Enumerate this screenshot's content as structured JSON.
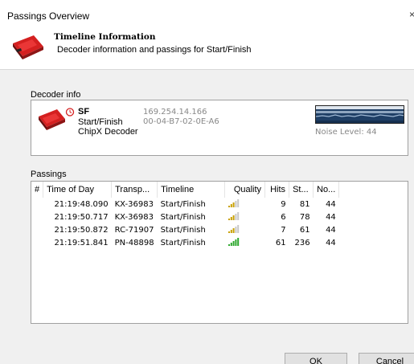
{
  "window": {
    "title": "Passings Overview",
    "close_glyph": "×"
  },
  "header": {
    "title": "Timeline Information",
    "subtitle": "Decoder information and passings for Start/Finish"
  },
  "decoder_info": {
    "group_label": "Decoder info",
    "id": "SF",
    "timeline": "Start/Finish",
    "type": "ChipX Decoder",
    "ip": "169.254.14.166",
    "mac": "00-04-B7-02-0E-A6",
    "noise_label": "Noise Level: 44",
    "noise_level": 44
  },
  "passings": {
    "group_label": "Passings",
    "columns": [
      "#",
      "Time of Day",
      "Transp...",
      "Timeline",
      "Quality",
      "Hits",
      "St...",
      "No..."
    ],
    "rows": [
      {
        "num": "",
        "time": "21:19:48.090",
        "transponder": "KX-36983",
        "timeline": "Start/Finish",
        "quality": 3,
        "hits": "9",
        "strength": "81",
        "noise": "44"
      },
      {
        "num": "",
        "time": "21:19:50.717",
        "transponder": "KX-36983",
        "timeline": "Start/Finish",
        "quality": 3,
        "hits": "6",
        "strength": "78",
        "noise": "44"
      },
      {
        "num": "",
        "time": "21:19:50.872",
        "transponder": "RC-71907",
        "timeline": "Start/Finish",
        "quality": 3,
        "hits": "7",
        "strength": "61",
        "noise": "44"
      },
      {
        "num": "",
        "time": "21:19:51.841",
        "transponder": "PN-48898",
        "timeline": "Start/Finish",
        "quality": 5,
        "hits": "61",
        "strength": "236",
        "noise": "44"
      }
    ]
  },
  "buttons": {
    "ok": "OK",
    "cancel": "Cancel"
  },
  "colors": {
    "quality_low": "#c8a000",
    "quality_high": "#2ea82e",
    "quality_empty": "#c8c8c8",
    "graph_bg": "#1f3f66"
  }
}
